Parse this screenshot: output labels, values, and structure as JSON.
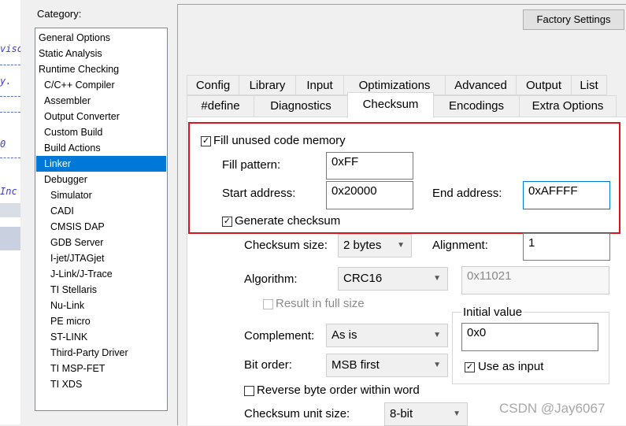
{
  "editor_fragments": [
    "visc",
    "y.",
    "0",
    "Inc"
  ],
  "category": {
    "label": "Category:",
    "items": [
      "General Options",
      "Static Analysis",
      "Runtime Checking",
      "C/C++ Compiler",
      "Assembler",
      "Output Converter",
      "Custom Build",
      "Build Actions",
      "Linker",
      "Debugger",
      "Simulator",
      "CADI",
      "CMSIS DAP",
      "GDB Server",
      "I-jet/JTAGjet",
      "J-Link/J-Trace",
      "TI Stellaris",
      "Nu-Link",
      "PE micro",
      "ST-LINK",
      "Third-Party Driver",
      "TI MSP-FET",
      "TI XDS"
    ],
    "selected": "Linker"
  },
  "factory_settings_label": "Factory Settings",
  "tabs_row1": [
    "Config",
    "Library",
    "Input",
    "Optimizations",
    "Advanced",
    "Output",
    "List"
  ],
  "tabs_row2": [
    "#define",
    "Diagnostics",
    "Checksum",
    "Encodings",
    "Extra Options"
  ],
  "active_tab": "Checksum",
  "fill_unused": {
    "label": "Fill unused code memory",
    "checked": true
  },
  "fill_pattern": {
    "label": "Fill pattern:",
    "value": "0xFF"
  },
  "start_address": {
    "label": "Start address:",
    "value": "0x20000"
  },
  "end_address": {
    "label": "End address:",
    "value": "0xAFFFF"
  },
  "generate_checksum": {
    "label": "Generate checksum",
    "checked": true
  },
  "checksum_size": {
    "label": "Checksum size:",
    "value": "2 bytes"
  },
  "alignment": {
    "label": "Alignment:",
    "value": "1"
  },
  "algorithm": {
    "label": "Algorithm:",
    "value": "CRC16",
    "poly": "0x11021"
  },
  "result_full_size": {
    "label": "Result in full size",
    "checked": false
  },
  "initial_value": {
    "title": "Initial value",
    "value": "0x0",
    "use_as_input": "Use as input",
    "use_checked": true
  },
  "complement": {
    "label": "Complement:",
    "value": "As is"
  },
  "bit_order": {
    "label": "Bit order:",
    "value": "MSB first"
  },
  "reverse_byte": {
    "label": "Reverse byte order within word",
    "checked": false
  },
  "unit_size": {
    "label": "Checksum unit size:",
    "value": "8-bit"
  },
  "watermark": "CSDN @Jay6067",
  "colors": {
    "selection": "#0078d7",
    "highlight_box": "#d9141e"
  }
}
